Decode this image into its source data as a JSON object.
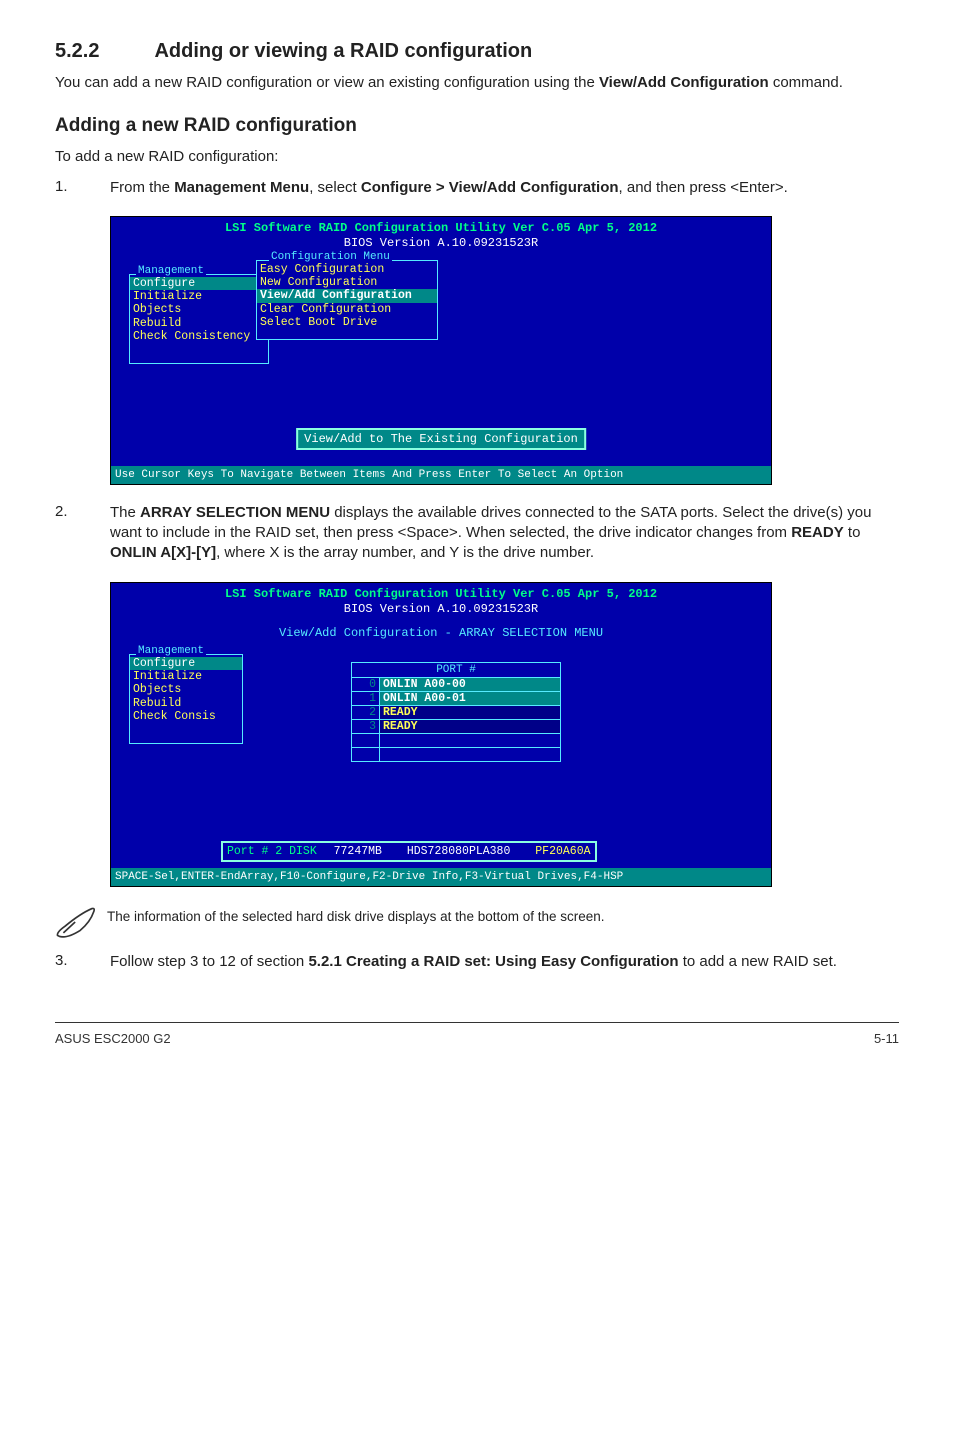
{
  "section": {
    "num": "5.2.2",
    "title": "Adding or viewing a RAID configuration"
  },
  "intro": {
    "p1a": "You can add a new RAID configuration or view an existing configuration using the ",
    "p1b": "View/Add Configuration",
    "p1c": " command."
  },
  "sub1": "Adding a new RAID configuration",
  "sub1p": "To add a new RAID configuration:",
  "step1": {
    "num": "1.",
    "a": "From the ",
    "b": "Management Menu",
    "c": ", select ",
    "d": "Configure > View/Add Configuration",
    "e": ", and then press <Enter>."
  },
  "bios1": {
    "hdr1": "LSI Software RAID Configuration Utility Ver C.05 Apr 5, 2012",
    "hdr2": "BIOS Version   A.10.09231523R",
    "mgmt_label": "Management",
    "mgmt_items": [
      "Configure",
      "Initialize",
      "Objects",
      "Rebuild",
      "Check Consistency"
    ],
    "cfg_label": "Configuration Menu",
    "cfg_items": [
      "Easy Configuration",
      "New Configuration",
      "View/Add Configuration",
      "Clear Configuration",
      "Select Boot Drive"
    ],
    "cfg_selected": 2,
    "center": "View/Add to The Existing Configuration",
    "footer": "Use Cursor Keys To Navigate Between Items And Press Enter To Select An Option"
  },
  "step2": {
    "num": "2.",
    "a": "The ",
    "b": "ARRAY SELECTION MENU",
    "c": " displays the available drives connected to the SATA ports. Select the drive(s) you want to include in the RAID set, then press <Space>. When selected, the drive indicator changes from ",
    "d": "READY",
    "e": " to ",
    "f": "ONLIN A[X]-[Y]",
    "g": ", where X is the array number, and Y is the drive number."
  },
  "bios2": {
    "hdr1": "LSI Software RAID Configuration Utility Ver C.05 Apr 5, 2012",
    "hdr2": "BIOS Version   A.10.09231523R",
    "sel_label": "View/Add Configuration - ARRAY SELECTION MENU",
    "mgmt_label": "Management",
    "mgmt_items": [
      "Configure",
      "Initialize",
      "Objects",
      "Rebuild",
      "Check Consis"
    ],
    "port_header": "PORT #",
    "rows": [
      {
        "idx": "0",
        "val": "ONLIN A00-00",
        "cls": "onlin"
      },
      {
        "idx": "1",
        "val": "ONLIN A00-01",
        "cls": "onlin"
      },
      {
        "idx": "2",
        "val": "READY",
        "cls": "ready"
      },
      {
        "idx": "3",
        "val": "READY",
        "cls": "ready"
      },
      {
        "idx": "",
        "val": "",
        "cls": ""
      },
      {
        "idx": "",
        "val": "",
        "cls": ""
      }
    ],
    "info": {
      "label": "Port # 2 DISK",
      "size": "77247MB",
      "model": "HDS728080PLA380",
      "rev": "PF20A60A"
    },
    "footer": "SPACE-Sel,ENTER-EndArray,F10-Configure,F2-Drive Info,F3-Virtual Drives,F4-HSP"
  },
  "note": "The information of the selected hard disk drive displays at the bottom of the screen.",
  "step3": {
    "num": "3.",
    "a": "Follow step 3 to 12 of section ",
    "b": "5.2.1 Creating a RAID set: Using Easy Configuration",
    "c": " to add a new RAID set."
  },
  "footer": {
    "left": "ASUS ESC2000 G2",
    "right": "5-11"
  }
}
